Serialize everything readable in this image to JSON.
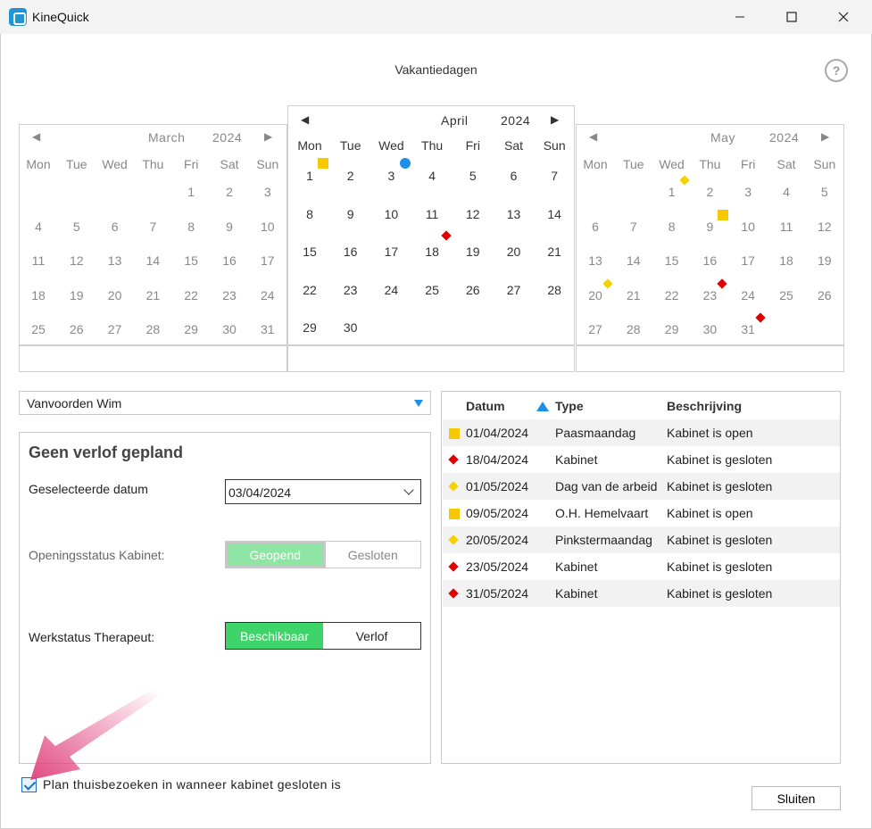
{
  "window": {
    "app_title": "KineQuick",
    "minimize": "—",
    "maximize": "☐",
    "close": "✕"
  },
  "page": {
    "title": "Vakantiedagen",
    "help": "?"
  },
  "calendars": {
    "left": {
      "month": "March",
      "year": "2024",
      "prev": "◀",
      "next": "▶"
    },
    "center": {
      "month": "April",
      "year": "2024",
      "prev": "◀",
      "next": "▶"
    },
    "right": {
      "month": "May",
      "year": "2024",
      "prev": "◀",
      "next": "▶"
    },
    "weekdays": [
      "Mon",
      "Tue",
      "Wed",
      "Thu",
      "Fri",
      "Sat",
      "Sun"
    ]
  },
  "person": {
    "selected": "Vanvoorden Wim"
  },
  "detail": {
    "title": "Geen verlof gepland",
    "date_label": "Geselecteerde datum",
    "date_value": "03/04/2024",
    "opening_label": "Openingsstatus Kabinet:",
    "opening_on": "Geopend",
    "opening_off": "Gesloten",
    "work_label": "Werkstatus Therapeut:",
    "work_on": "Beschikbaar",
    "work_off": "Verlof"
  },
  "table": {
    "headers": {
      "datum": "Datum",
      "type": "Type",
      "beschrijving": "Beschrijving"
    },
    "rows": [
      {
        "marker": "square-yellow",
        "datum": "01/04/2024",
        "type": "Paasmaandag",
        "beschrijving": "Kabinet is open"
      },
      {
        "marker": "diamond-red",
        "datum": "18/04/2024",
        "type": "Kabinet",
        "beschrijving": "Kabinet is gesloten"
      },
      {
        "marker": "diamond-yellow",
        "datum": "01/05/2024",
        "type": "Dag van de arbeid",
        "beschrijving": "Kabinet is gesloten"
      },
      {
        "marker": "square-yellow",
        "datum": "09/05/2024",
        "type": "O.H. Hemelvaart",
        "beschrijving": "Kabinet is open"
      },
      {
        "marker": "diamond-yellow",
        "datum": "20/05/2024",
        "type": "Pinkstermaandag",
        "beschrijving": "Kabinet is gesloten"
      },
      {
        "marker": "diamond-red",
        "datum": "23/05/2024",
        "type": "Kabinet",
        "beschrijving": "Kabinet is gesloten"
      },
      {
        "marker": "diamond-red",
        "datum": "31/05/2024",
        "type": "Kabinet",
        "beschrijving": "Kabinet is gesloten"
      }
    ]
  },
  "footer": {
    "checkbox_label": "Plan thuisbezoeken in wanneer kabinet gesloten is",
    "checkbox_checked": true,
    "close_button": "Sluiten"
  },
  "colors": {
    "accent_blue": "#1e8fe6",
    "holiday_yellow": "#f5c800",
    "closed_red": "#e00000",
    "available_green": "#3fd46a",
    "arrow_pink": "#e0407a"
  }
}
